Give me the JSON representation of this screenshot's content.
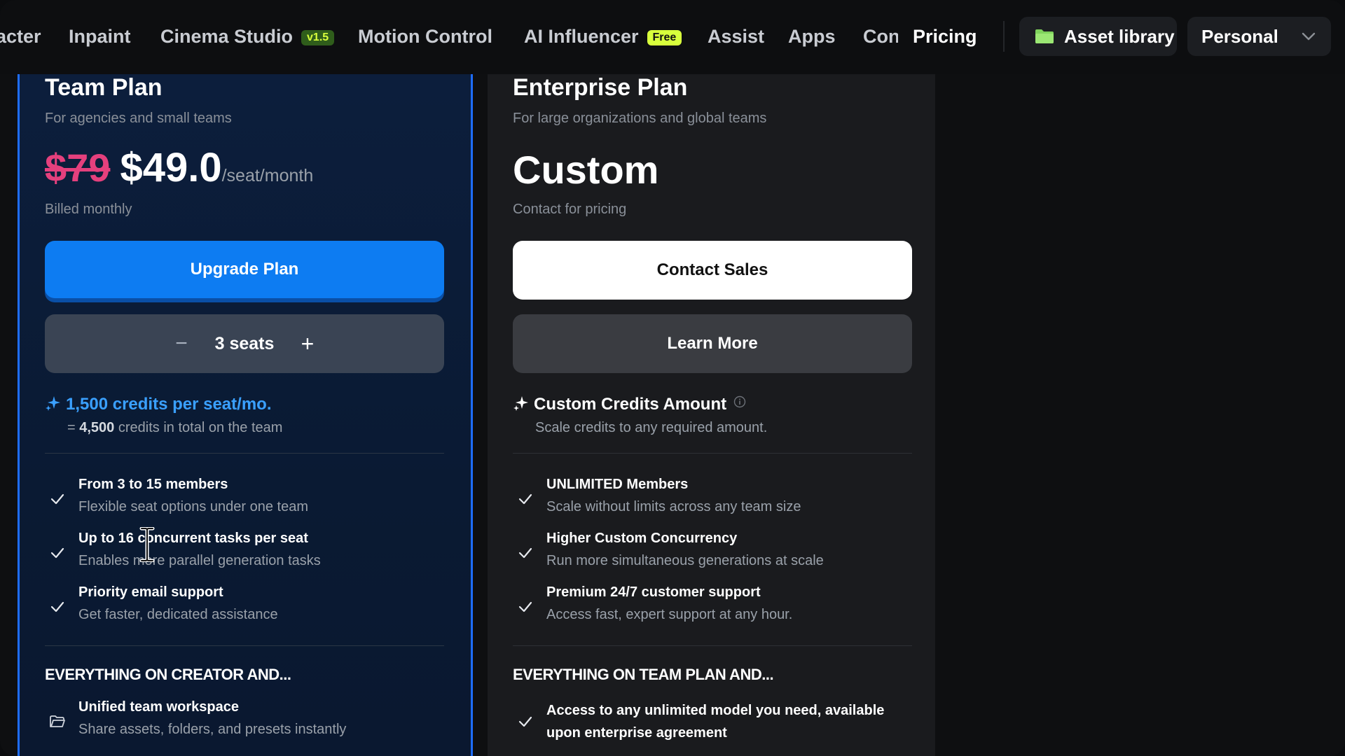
{
  "nav": {
    "items": [
      {
        "label": "acter",
        "badge": ""
      },
      {
        "label": "Inpaint",
        "badge": ""
      },
      {
        "label": "Cinema Studio",
        "badge": "v1.5"
      },
      {
        "label": "Motion Control",
        "badge": ""
      },
      {
        "label": "AI Influencer",
        "badge": "Free"
      },
      {
        "label": "Assist",
        "badge": ""
      },
      {
        "label": "Apps",
        "badge": ""
      },
      {
        "label": "Con",
        "badge": ""
      },
      {
        "label": "Pricing",
        "badge": ""
      }
    ],
    "asset_library_label": "Asset library",
    "workspace_label": "Personal"
  },
  "team_plan": {
    "title": "Team Plan",
    "subtitle": "For agencies and small teams",
    "old_price": "$79",
    "price": "$49.0",
    "price_unit": "/seat/month",
    "billing": "Billed monthly",
    "cta_label": "Upgrade Plan",
    "seats_label": "3 seats",
    "seat_minus": "−",
    "seat_plus": "+",
    "credits_headline": "1,500 credits per seat/mo.",
    "credits_total_prefix": "= ",
    "credits_total_value": "4,500",
    "credits_total_suffix": " credits in total on the team",
    "features": [
      {
        "title": "From 3 to 15 members",
        "desc": "Flexible seat options under one team"
      },
      {
        "title": "Up to 16 concurrent tasks per seat",
        "desc": "Enables more parallel generation tasks"
      },
      {
        "title": "Priority email support",
        "desc": "Get faster, dedicated assistance"
      }
    ],
    "section_heading": "EVERYTHING ON CREATOR AND...",
    "section_features": [
      {
        "title": "Unified team workspace",
        "desc": "Share assets, folders, and presets instantly"
      }
    ]
  },
  "enterprise_plan": {
    "title": "Enterprise Plan",
    "subtitle": "For large organizations and global teams",
    "price": "Custom",
    "billing": "Contact for pricing",
    "cta_label": "Contact Sales",
    "secondary_label": "Learn More",
    "credits_headline": "Custom Credits Amount",
    "credits_sub": "Scale credits to any required amount.",
    "features": [
      {
        "title": "UNLIMITED Members",
        "desc": "Scale without limits across any team size"
      },
      {
        "title": "Higher Custom Concurrency",
        "desc": "Run more simultaneous generations at scale"
      },
      {
        "title": "Premium 24/7 customer support",
        "desc": "Access fast, expert support at any hour."
      }
    ],
    "section_heading": "EVERYTHING ON TEAM PLAN AND...",
    "section_features": [
      {
        "title": "Access to any unlimited model you need, available upon enterprise agreement"
      }
    ]
  },
  "colors": {
    "accent_blue": "#0d7cf2",
    "credits_blue": "#3aa0ff",
    "strike_pink": "#e5407d",
    "badge_lime": "#d8ff3c"
  },
  "icons": [
    "folder-icon",
    "chevron-down-icon",
    "sparkle-icon",
    "check-icon",
    "info-icon",
    "folder-open-icon",
    "text-cursor-icon"
  ]
}
